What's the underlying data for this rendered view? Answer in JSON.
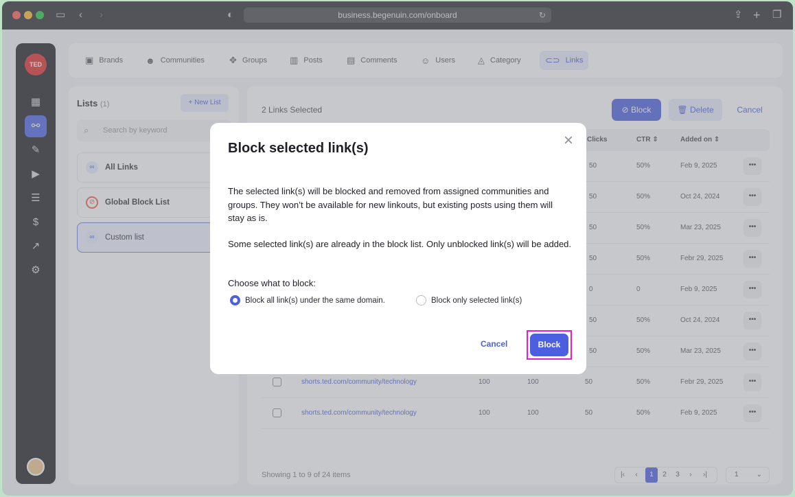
{
  "browser": {
    "url": "business.begenuin.com/onboard",
    "traffic_colors": [
      "#ff5f57",
      "#febc2e",
      "#28c840"
    ]
  },
  "sidebar": {
    "logo": "TED",
    "items": [
      {
        "icon": "grid-icon"
      },
      {
        "icon": "share-nodes-icon",
        "active": true
      },
      {
        "icon": "magic-wand-icon"
      },
      {
        "icon": "video-icon"
      },
      {
        "icon": "checklist-icon"
      },
      {
        "icon": "dollar-icon"
      },
      {
        "icon": "analytics-icon"
      },
      {
        "icon": "gear-icon"
      }
    ]
  },
  "topnav": {
    "tabs": [
      {
        "label": "Brands",
        "icon": "briefcase-icon"
      },
      {
        "label": "Communities",
        "icon": "people-icon"
      },
      {
        "label": "Groups",
        "icon": "groups-icon"
      },
      {
        "label": "Posts",
        "icon": "posts-icon"
      },
      {
        "label": "Comments",
        "icon": "comment-icon"
      },
      {
        "label": "Users",
        "icon": "users-icon"
      },
      {
        "label": "Category",
        "icon": "category-icon"
      },
      {
        "label": "Links",
        "icon": "link-icon",
        "active": true
      }
    ]
  },
  "lists": {
    "title": "Lists",
    "count": "(1)",
    "new_list": "New List",
    "search_placeholder": "Search by keyword",
    "items": [
      {
        "label": "All Links",
        "icon": "link-icon"
      },
      {
        "label": "Global Block List",
        "icon": "block-icon"
      },
      {
        "label": "Custom list",
        "icon": "link-icon",
        "selected": true
      }
    ]
  },
  "main": {
    "selected_text": "2 Links Selected",
    "block": "Block",
    "delete": "Delete",
    "cancel": "Cancel",
    "columns": {
      "clicks": "Clicks",
      "ctr": "CTR",
      "added_on": "Added on"
    },
    "rows": [
      {
        "link": "",
        "c1": "",
        "c2": "",
        "clicks": "50",
        "ctr": "50%",
        "added": "Feb 9, 2025"
      },
      {
        "link": "",
        "c1": "",
        "c2": "",
        "clicks": "50",
        "ctr": "50%",
        "added": "Oct 24, 2024"
      },
      {
        "link": "",
        "c1": "",
        "c2": "",
        "clicks": "50",
        "ctr": "50%",
        "added": "Mar 23, 2025"
      },
      {
        "link": "",
        "c1": "",
        "c2": "",
        "clicks": "50",
        "ctr": "50%",
        "added": "Febr 29, 2025"
      },
      {
        "link": "",
        "c1": "",
        "c2": "",
        "clicks": "0",
        "ctr": "0",
        "added": "Feb 9, 2025"
      },
      {
        "link": "",
        "c1": "",
        "c2": "",
        "clicks": "50",
        "ctr": "50%",
        "added": "Oct 24, 2024"
      },
      {
        "link": "",
        "c1": "",
        "c2": "",
        "clicks": "50",
        "ctr": "50%",
        "added": "Mar 23, 2025"
      },
      {
        "link": "shorts.ted.com/community/technology",
        "c1": "100",
        "c2": "100",
        "clicks": "50",
        "ctr": "50%",
        "added": "Febr 29, 2025"
      },
      {
        "link": "shorts.ted.com/community/technology",
        "c1": "100",
        "c2": "100",
        "clicks": "50",
        "ctr": "50%",
        "added": "Feb 9, 2025"
      }
    ],
    "more": "•••",
    "showing": "Showing 1 to 9 of 24 items",
    "pages": [
      "1",
      "2",
      "3"
    ],
    "current_page": "1",
    "per_page": "1"
  },
  "modal": {
    "title": "Block selected link(s)",
    "paragraph1": "The selected link(s) will be blocked and removed from assigned communities and groups. They won’t be available for new linkouts, but existing posts using them will stay as is.",
    "paragraph2": "Some selected link(s) are already in the block list. Only unblocked link(s) will be added.",
    "choose_label": "Choose what to block:",
    "option1": "Block all link(s) under the same domain.",
    "option2": "Block only selected link(s)",
    "selected_option": 1,
    "cancel": "Cancel",
    "block": "Block",
    "accent": "#4b5fe0",
    "highlight_color": "#e21cc8"
  }
}
